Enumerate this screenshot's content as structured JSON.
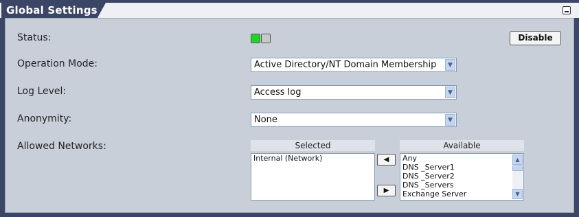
{
  "panel": {
    "title": "Global Settings"
  },
  "status": {
    "label": "Status:",
    "leds": [
      "on",
      "off"
    ],
    "toggle_label": "Disable"
  },
  "operation_mode": {
    "label": "Operation Mode:",
    "value": "Active Directory/NT Domain Membership"
  },
  "log_level": {
    "label": "Log Level:",
    "value": "Access log"
  },
  "anonymity": {
    "label": "Anonymity:",
    "value": "None"
  },
  "allowed_networks": {
    "label": "Allowed Networks:",
    "selected_header": "Selected",
    "available_header": "Available",
    "selected_items": [
      "Internal (Network)"
    ],
    "available_items": [
      "Any",
      "DNS _Server1",
      "DNS _Server2",
      "DNS _Servers",
      "Exchange Server"
    ],
    "move_left_glyph": "◀",
    "move_right_glyph": "▶"
  },
  "icons": {
    "dropdown": "chevron-down-icon",
    "minimize": "minimize-icon"
  },
  "colors": {
    "frame": "#3b4566",
    "content_bg": "#c9cfd9",
    "led_on": "#22d12a",
    "led_off": "#c8c8c8"
  }
}
